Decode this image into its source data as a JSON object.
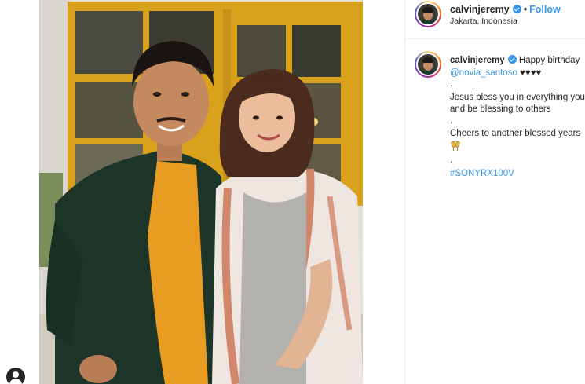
{
  "post": {
    "username": "calvinjeremy",
    "follow_label": "Follow",
    "separator": "•",
    "location": "Jakarta, Indonesia"
  },
  "caption": {
    "username": "calvinjeremy",
    "text_first": "Happy birthday",
    "mention": "@novia_santoso",
    "hearts": "♥♥♥♥",
    "dot1": ".",
    "line1": "Jesus bless you in everything you",
    "line2": "and be blessing to others",
    "dot2": ".",
    "line3": "Cheers to another blessed years",
    "dot3": ".",
    "hashtag": "#SONYRX100V"
  },
  "icons": {
    "verified": "verified-badge-icon",
    "cheers": "clinking-glasses-icon",
    "profile": "profile-avatar-icon"
  },
  "colors": {
    "link": "#3897f0",
    "text": "#262626",
    "border": "#efefef"
  }
}
